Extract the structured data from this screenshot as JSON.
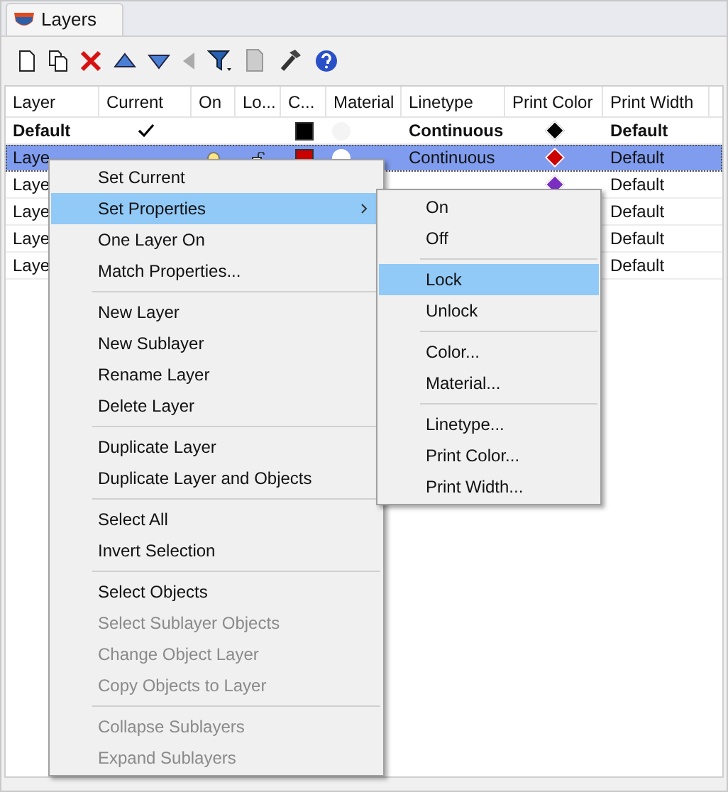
{
  "tab": {
    "title": "Layers"
  },
  "columns": [
    "Layer",
    "Current",
    "On",
    "Lo...",
    "C...",
    "Material",
    "Linetype",
    "Print Color",
    "Print Width"
  ],
  "rows": [
    {
      "name": "Default",
      "current": true,
      "selected": false,
      "bold": true,
      "color": "#000000",
      "linetype": "Continuous",
      "print_color": {
        "color": "#000000"
      },
      "print_width": "Default"
    },
    {
      "name": "Laye",
      "current": false,
      "selected": true,
      "bold": false,
      "on": true,
      "color": "#cc0000",
      "linetype": "Continuous",
      "print_color": {
        "color": "#cc0000"
      },
      "print_width": "Default"
    },
    {
      "name": "Laye",
      "selected": false,
      "bold": false,
      "print_color": {
        "color": "#7a2fc0"
      },
      "print_width": "Default"
    },
    {
      "name": "Laye",
      "selected": false,
      "bold": false,
      "print_width": "Default"
    },
    {
      "name": "Laye",
      "selected": false,
      "bold": false,
      "print_width": "Default"
    },
    {
      "name": "Laye",
      "selected": false,
      "bold": false,
      "print_width": "Default"
    }
  ],
  "context_menu": [
    {
      "kind": "item",
      "label": "Set Current",
      "selected": false,
      "disabled": false
    },
    {
      "kind": "item",
      "label": "Set Properties",
      "selected": true,
      "disabled": false,
      "submenu": true
    },
    {
      "kind": "item",
      "label": "One Layer On",
      "selected": false,
      "disabled": false
    },
    {
      "kind": "item",
      "label": "Match Properties...",
      "selected": false,
      "disabled": false
    },
    {
      "kind": "separator"
    },
    {
      "kind": "item",
      "label": "New Layer",
      "selected": false,
      "disabled": false
    },
    {
      "kind": "item",
      "label": "New Sublayer",
      "selected": false,
      "disabled": false
    },
    {
      "kind": "item",
      "label": "Rename Layer",
      "selected": false,
      "disabled": false
    },
    {
      "kind": "item",
      "label": "Delete Layer",
      "selected": false,
      "disabled": false
    },
    {
      "kind": "separator"
    },
    {
      "kind": "item",
      "label": "Duplicate Layer",
      "selected": false,
      "disabled": false
    },
    {
      "kind": "item",
      "label": "Duplicate Layer and Objects",
      "selected": false,
      "disabled": false
    },
    {
      "kind": "separator"
    },
    {
      "kind": "item",
      "label": "Select All",
      "selected": false,
      "disabled": false
    },
    {
      "kind": "item",
      "label": "Invert Selection",
      "selected": false,
      "disabled": false
    },
    {
      "kind": "separator"
    },
    {
      "kind": "item",
      "label": "Select Objects",
      "selected": false,
      "disabled": false
    },
    {
      "kind": "item",
      "label": "Select Sublayer Objects",
      "selected": false,
      "disabled": true
    },
    {
      "kind": "item",
      "label": "Change Object Layer",
      "selected": false,
      "disabled": true
    },
    {
      "kind": "item",
      "label": "Copy Objects to Layer",
      "selected": false,
      "disabled": true
    },
    {
      "kind": "separator"
    },
    {
      "kind": "item",
      "label": "Collapse Sublayers",
      "selected": false,
      "disabled": true
    },
    {
      "kind": "item",
      "label": "Expand Sublayers",
      "selected": false,
      "disabled": true
    }
  ],
  "submenu": [
    {
      "kind": "item",
      "label": "On",
      "selected": false
    },
    {
      "kind": "item",
      "label": "Off",
      "selected": false
    },
    {
      "kind": "separator"
    },
    {
      "kind": "item",
      "label": "Lock",
      "selected": true
    },
    {
      "kind": "item",
      "label": "Unlock",
      "selected": false
    },
    {
      "kind": "separator"
    },
    {
      "kind": "item",
      "label": "Color...",
      "selected": false
    },
    {
      "kind": "item",
      "label": "Material...",
      "selected": false
    },
    {
      "kind": "separator"
    },
    {
      "kind": "item",
      "label": "Linetype...",
      "selected": false
    },
    {
      "kind": "item",
      "label": "Print Color...",
      "selected": false
    },
    {
      "kind": "item",
      "label": "Print Width...",
      "selected": false
    }
  ]
}
